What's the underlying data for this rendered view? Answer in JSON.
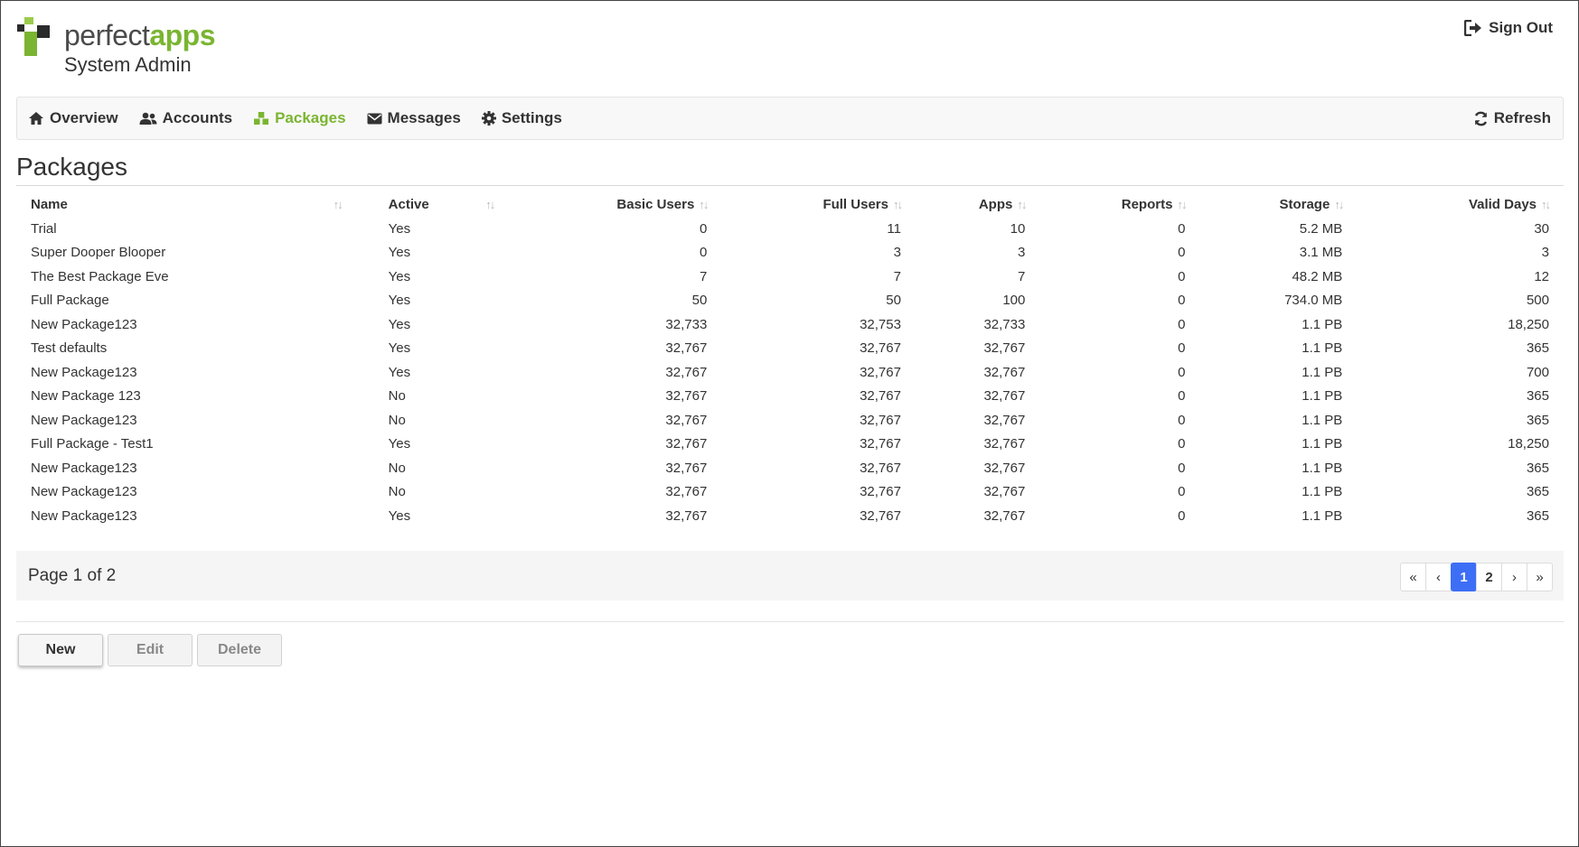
{
  "brand": {
    "word1": "perfect",
    "word2": "apps",
    "subtitle": "System Admin",
    "colors": {
      "green": "#7ab531",
      "dark": "#2b2b2b",
      "light_green": "#9bcb4b"
    }
  },
  "header": {
    "signout_label": "Sign Out",
    "signout_icon": "sign-out-icon"
  },
  "nav": {
    "items": [
      {
        "label": "Overview",
        "icon": "home-icon",
        "active": false
      },
      {
        "label": "Accounts",
        "icon": "users-icon",
        "active": false
      },
      {
        "label": "Packages",
        "icon": "cubes-icon",
        "active": true
      },
      {
        "label": "Messages",
        "icon": "envelope-icon",
        "active": false
      },
      {
        "label": "Settings",
        "icon": "gear-icon",
        "active": false
      }
    ],
    "refresh_label": "Refresh",
    "active_color": "#7ab531"
  },
  "page": {
    "title": "Packages"
  },
  "table": {
    "columns": [
      "Name",
      "Active",
      "Basic Users",
      "Full Users",
      "Apps",
      "Reports",
      "Storage",
      "Valid Days"
    ],
    "rows": [
      [
        "Trial",
        "Yes",
        "0",
        "11",
        "10",
        "0",
        "5.2 MB",
        "30"
      ],
      [
        "Super Dooper Blooper",
        "Yes",
        "0",
        "3",
        "3",
        "0",
        "3.1 MB",
        "3"
      ],
      [
        "The Best Package Eve",
        "Yes",
        "7",
        "7",
        "7",
        "0",
        "48.2 MB",
        "12"
      ],
      [
        "Full Package",
        "Yes",
        "50",
        "50",
        "100",
        "0",
        "734.0 MB",
        "500"
      ],
      [
        "New Package123",
        "Yes",
        "32,733",
        "32,753",
        "32,733",
        "0",
        "1.1 PB",
        "18,250"
      ],
      [
        "Test defaults",
        "Yes",
        "32,767",
        "32,767",
        "32,767",
        "0",
        "1.1 PB",
        "365"
      ],
      [
        "New Package123",
        "Yes",
        "32,767",
        "32,767",
        "32,767",
        "0",
        "1.1 PB",
        "700"
      ],
      [
        "New Package 123",
        "No",
        "32,767",
        "32,767",
        "32,767",
        "0",
        "1.1 PB",
        "365"
      ],
      [
        "New Package123",
        "No",
        "32,767",
        "32,767",
        "32,767",
        "0",
        "1.1 PB",
        "365"
      ],
      [
        "Full Package - Test1",
        "Yes",
        "32,767",
        "32,767",
        "32,767",
        "0",
        "1.1 PB",
        "18,250"
      ],
      [
        "New Package123",
        "No",
        "32,767",
        "32,767",
        "32,767",
        "0",
        "1.1 PB",
        "365"
      ],
      [
        "New Package123",
        "No",
        "32,767",
        "32,767",
        "32,767",
        "0",
        "1.1 PB",
        "365"
      ],
      [
        "New Package123",
        "Yes",
        "32,767",
        "32,767",
        "32,767",
        "0",
        "1.1 PB",
        "365"
      ]
    ]
  },
  "pagination": {
    "info": "Page 1 of 2",
    "first": "«",
    "prev": "‹",
    "pages": [
      "1",
      "2"
    ],
    "current": "1",
    "next": "›",
    "last": "»",
    "current_color": "#3d6ef6"
  },
  "actions": {
    "new_label": "New",
    "edit_label": "Edit",
    "delete_label": "Delete"
  }
}
